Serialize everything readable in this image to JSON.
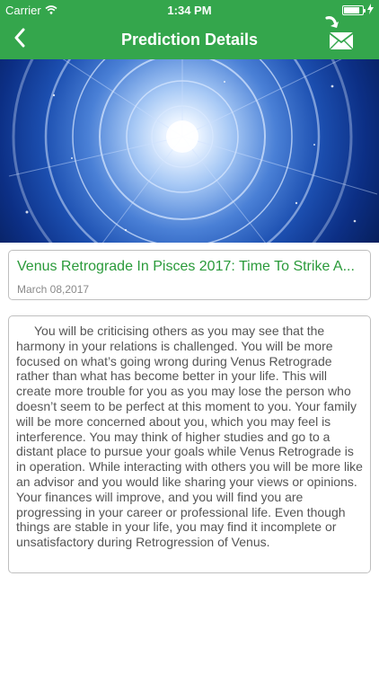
{
  "status_bar": {
    "carrier": "Carrier",
    "time": "1:34 PM"
  },
  "nav": {
    "title": "Prediction Details",
    "back_icon": "chevron-left-icon",
    "share_icon": "mail-share-icon"
  },
  "article": {
    "title": "Venus Retrograde In Pisces 2017: Time To Strike A...",
    "date": "March 08,2017",
    "body": "You will be criticising others as you may see that the harmony in your relations is challenged. You will be more focused on what’s going wrong during Venus Retrograde rather than what has become better in your life. This will create more trouble for you as you may lose the person who doesn’t seem to be perfect at this moment to you. Your family will be more concerned about you, which you may feel is interference. You may think of higher studies and go to a distant place to pursue your goals while Venus Retrograde is in operation. While interacting with others you will be more like an advisor and you would like sharing your views or opinions. Your finances will improve, and you will find you are progressing in your career or professional life. Even though things are stable in your life, you may find it incomplete or unsatisfactory during Retrogression of Venus."
  },
  "colors": {
    "nav_green": "#34a64c",
    "title_green": "#2a9a3a"
  }
}
